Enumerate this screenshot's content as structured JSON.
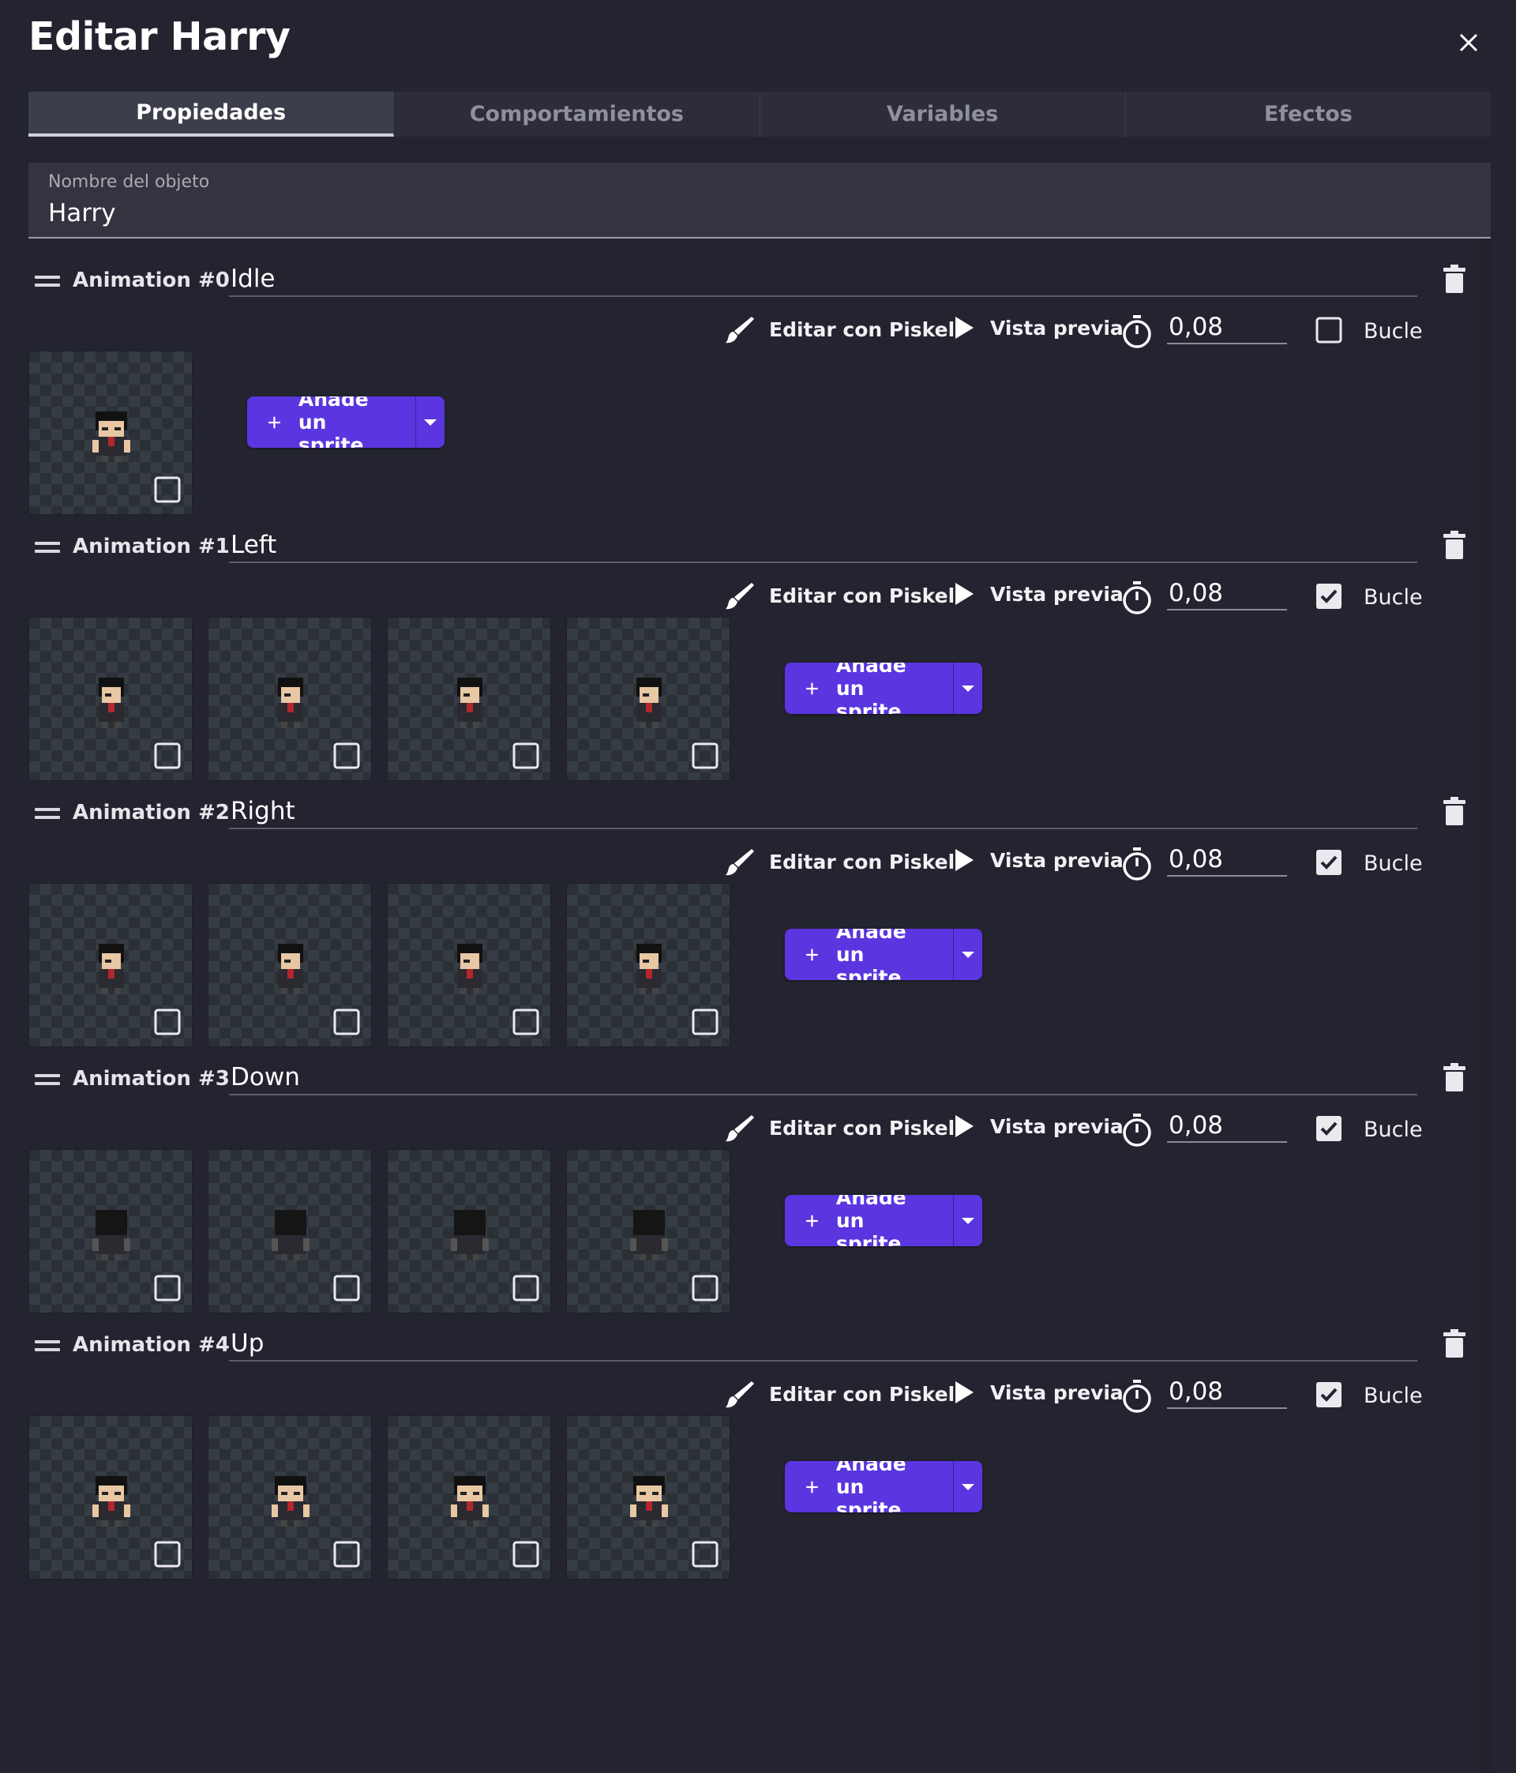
{
  "dialog": {
    "title": "Editar Harry"
  },
  "tabs": [
    {
      "label": "Propiedades",
      "active": true
    },
    {
      "label": "Comportamientos",
      "active": false
    },
    {
      "label": "Variables",
      "active": false
    },
    {
      "label": "Efectos",
      "active": false
    }
  ],
  "object_name": {
    "label": "Nombre del objeto",
    "value": "Harry"
  },
  "common": {
    "edit_label": "Editar con Piskel",
    "preview_label": "Vista previa",
    "loop_label": "Bucle",
    "add_sprite_label": "Añade un sprite"
  },
  "icons": {
    "close": "close-icon",
    "drag": "drag-handle-icon",
    "trash": "trash-icon",
    "brush": "brush-icon",
    "play": "play-icon",
    "timer": "timer-icon",
    "plus": "plus-icon",
    "dropdown": "chevron-down-icon"
  },
  "colors": {
    "background": "#23242f",
    "accent": "#5a35e0",
    "tab_active_bg": "#3d3e4b",
    "field_bg": "#33343f"
  },
  "animations": [
    {
      "label": "Animation #0",
      "name": "Idle",
      "duration": "0,08",
      "loop": false,
      "frame_count": 1,
      "pose": "front"
    },
    {
      "label": "Animation #1",
      "name": "Left",
      "duration": "0,08",
      "loop": true,
      "frame_count": 4,
      "pose": "side"
    },
    {
      "label": "Animation #2",
      "name": "Right",
      "duration": "0,08",
      "loop": true,
      "frame_count": 4,
      "pose": "side"
    },
    {
      "label": "Animation #3",
      "name": "Down",
      "duration": "0,08",
      "loop": true,
      "frame_count": 4,
      "pose": "back"
    },
    {
      "label": "Animation #4",
      "name": "Up",
      "duration": "0,08",
      "loop": true,
      "frame_count": 4,
      "pose": "front"
    }
  ]
}
